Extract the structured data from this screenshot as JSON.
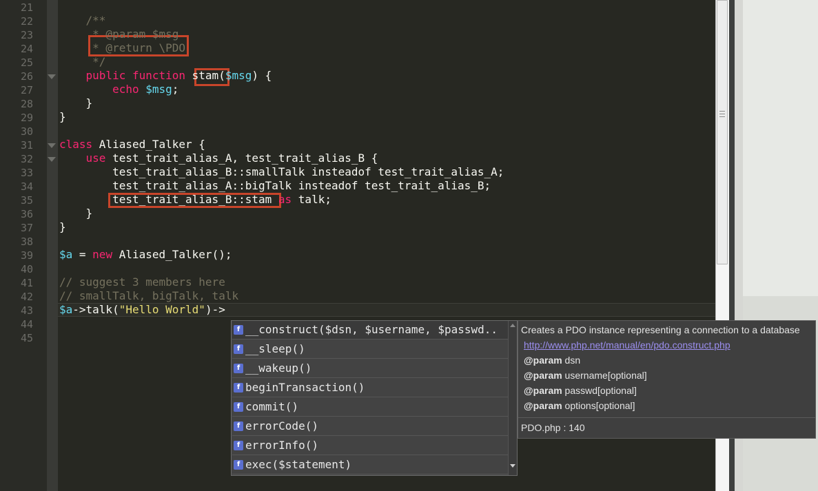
{
  "editor": {
    "lines": [
      {
        "no": "21",
        "parts": []
      },
      {
        "no": "22",
        "parts": [
          {
            "c": "cmt",
            "t": "    /**"
          }
        ]
      },
      {
        "no": "23",
        "parts": [
          {
            "c": "cmt",
            "t": "     * @param $msg"
          }
        ]
      },
      {
        "no": "24",
        "parts": [
          {
            "c": "cmt",
            "t": "     * @return \\PDO"
          }
        ]
      },
      {
        "no": "25",
        "parts": [
          {
            "c": "cmt",
            "t": "     */"
          }
        ]
      },
      {
        "no": "26",
        "parts": [
          {
            "c": "kw",
            "t": "    public function "
          },
          {
            "c": "pl",
            "t": "stam("
          },
          {
            "c": "var",
            "t": "$msg"
          },
          {
            "c": "pl",
            "t": ") {"
          }
        ]
      },
      {
        "no": "27",
        "parts": [
          {
            "c": "kw",
            "t": "        echo "
          },
          {
            "c": "var",
            "t": "$msg"
          },
          {
            "c": "pl",
            "t": ";"
          }
        ]
      },
      {
        "no": "28",
        "parts": [
          {
            "c": "pl",
            "t": "    }"
          }
        ]
      },
      {
        "no": "29",
        "parts": [
          {
            "c": "pl",
            "t": "}"
          }
        ]
      },
      {
        "no": "30",
        "parts": []
      },
      {
        "no": "31",
        "parts": [
          {
            "c": "kw",
            "t": "class "
          },
          {
            "c": "pl",
            "t": "Aliased_Talker {"
          }
        ]
      },
      {
        "no": "32",
        "parts": [
          {
            "c": "kw",
            "t": "    use "
          },
          {
            "c": "pl",
            "t": "test_trait_alias_A, test_trait_alias_B {"
          }
        ]
      },
      {
        "no": "33",
        "parts": [
          {
            "c": "pl",
            "t": "        test_trait_alias_B::smallTalk insteadof test_trait_alias_A;"
          }
        ]
      },
      {
        "no": "34",
        "parts": [
          {
            "c": "pl",
            "t": "        test_trait_alias_A::bigTalk insteadof test_trait_alias_B;"
          }
        ]
      },
      {
        "no": "35",
        "parts": [
          {
            "c": "pl",
            "t": "        test_trait_alias_B::stam "
          },
          {
            "c": "kw",
            "t": "as "
          },
          {
            "c": "pl",
            "t": "talk;"
          }
        ]
      },
      {
        "no": "36",
        "parts": [
          {
            "c": "pl",
            "t": "    }"
          }
        ]
      },
      {
        "no": "37",
        "parts": [
          {
            "c": "pl",
            "t": "}"
          }
        ]
      },
      {
        "no": "38",
        "parts": []
      },
      {
        "no": "39",
        "parts": [
          {
            "c": "var",
            "t": "$a"
          },
          {
            "c": "pl",
            "t": " = "
          },
          {
            "c": "kw",
            "t": "new "
          },
          {
            "c": "pl",
            "t": "Aliased_Talker();"
          }
        ]
      },
      {
        "no": "40",
        "parts": []
      },
      {
        "no": "41",
        "parts": [
          {
            "c": "cmt",
            "t": "// suggest 3 members here"
          }
        ]
      },
      {
        "no": "42",
        "parts": [
          {
            "c": "cmt",
            "t": "// smallTalk, bigTalk, talk"
          }
        ]
      },
      {
        "no": "43",
        "parts": [
          {
            "c": "var",
            "t": "$a"
          },
          {
            "c": "pl",
            "t": "->talk("
          },
          {
            "c": "str",
            "t": "\"Hello World\""
          },
          {
            "c": "pl",
            "t": ")->"
          }
        ]
      },
      {
        "no": "44",
        "parts": []
      },
      {
        "no": "45",
        "parts": []
      }
    ],
    "fold_lines": [
      "26",
      "31",
      "32"
    ],
    "colors": {
      "background": "#272822",
      "comment": "#75715e",
      "keyword": "#f92672",
      "variable": "#66d9ef",
      "string": "#e6db74",
      "plain": "#f8f8f2",
      "highlight_box": "#c8452a"
    }
  },
  "completion": {
    "items": [
      {
        "icon": "method-icon",
        "label": "__construct($dsn, $username, $passwd.."
      },
      {
        "icon": "method-icon",
        "label": "__sleep()"
      },
      {
        "icon": "method-icon",
        "label": "__wakeup()"
      },
      {
        "icon": "method-icon",
        "label": "beginTransaction()"
      },
      {
        "icon": "method-icon",
        "label": "commit()"
      },
      {
        "icon": "method-icon",
        "label": "errorCode()"
      },
      {
        "icon": "method-icon",
        "label": "errorInfo()"
      },
      {
        "icon": "method-icon",
        "label": "exec($statement)"
      }
    ],
    "icon_glyph": "f"
  },
  "doc": {
    "description": "Creates a PDO instance representing a connection to a database",
    "link": "http://www.php.net/manual/en/pdo.construct.php",
    "params": [
      {
        "tag": "@param",
        "text": " dsn"
      },
      {
        "tag": "@param",
        "text": " username[optional]"
      },
      {
        "tag": "@param",
        "text": " passwd[optional]"
      },
      {
        "tag": "@param",
        "text": " options[optional]"
      }
    ],
    "source": "PDO.php : 140"
  }
}
